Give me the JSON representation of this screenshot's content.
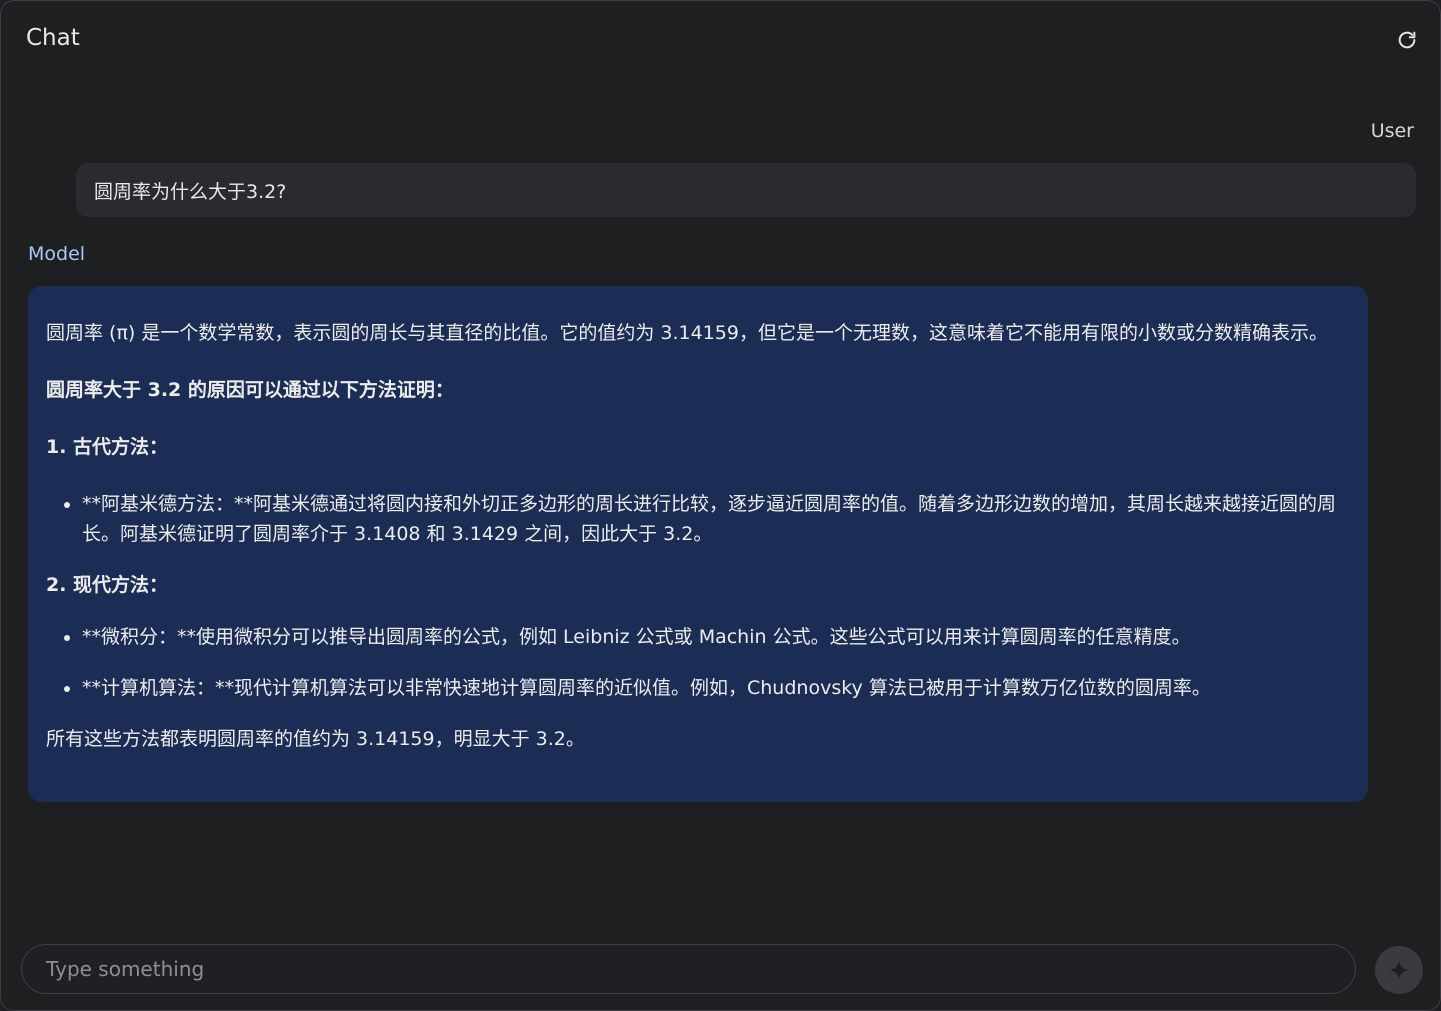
{
  "header": {
    "title": "Chat",
    "refresh_icon": "refresh-icon"
  },
  "conversation": {
    "user": {
      "label": "User",
      "message": "圆周率为什么大于3.2?"
    },
    "model": {
      "label": "Model",
      "intro": "圆周率 (π) 是一个数学常数，表示圆的周长与其直径的比值。它的值约为 3.14159，但它是一个无理数，这意味着它不能用有限的小数或分数精确表示。",
      "heading": "圆周率大于 3.2 的原因可以通过以下方法证明：",
      "section1_title": "1. 古代方法：",
      "section1_items": [
        "**阿基米德方法：**阿基米德通过将圆内接和外切正多边形的周长进行比较，逐步逼近圆周率的值。随着多边形边数的增加，其周长越来越接近圆的周长。阿基米德证明了圆周率介于 3.1408 和 3.1429 之间，因此大于 3.2。"
      ],
      "section2_title": "2. 现代方法：",
      "section2_items": [
        "**微积分：**使用微积分可以推导出圆周率的公式，例如 Leibniz 公式或 Machin 公式。这些公式可以用来计算圆周率的任意精度。",
        "**计算机算法：**现代计算机算法可以非常快速地计算圆周率的近似值。例如，Chudnovsky 算法已被用于计算数万亿位数的圆周率。"
      ],
      "conclusion": "所有这些方法都表明圆周率的值约为 3.14159，明显大于 3.2。"
    }
  },
  "composer": {
    "placeholder": "Type something",
    "value": "",
    "send_icon": "sparkle-icon"
  },
  "colors": {
    "background": "#1e1f21",
    "user_bubble": "#2a2b2e",
    "model_bubble": "#1b2d54",
    "model_label": "#a8c7fa"
  }
}
